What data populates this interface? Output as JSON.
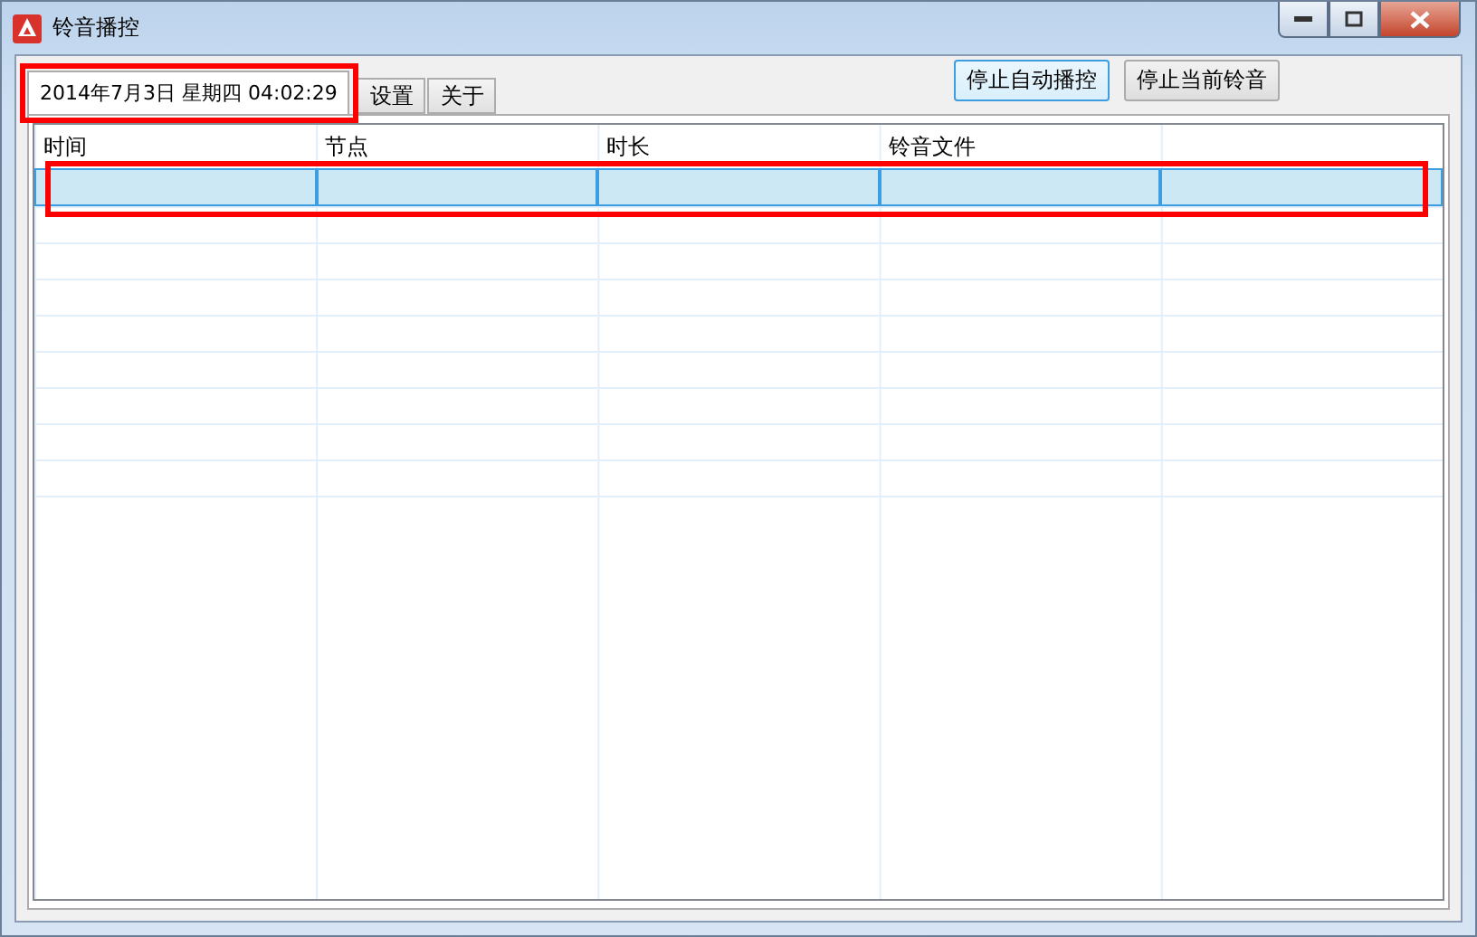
{
  "window": {
    "title": "铃音播控"
  },
  "tabs": [
    {
      "label": "2014年7月3日  星期四  04:02:29",
      "selected": true
    },
    {
      "label": "设置",
      "selected": false
    },
    {
      "label": "关于",
      "selected": false
    }
  ],
  "buttons": [
    {
      "label": "停止自动播控",
      "focused": true
    },
    {
      "label": "停止当前铃音",
      "focused": false
    }
  ],
  "table": {
    "columns": [
      "时间",
      "节点",
      "时长",
      "铃音文件"
    ],
    "rows": [
      {
        "selected": true
      }
    ]
  }
}
